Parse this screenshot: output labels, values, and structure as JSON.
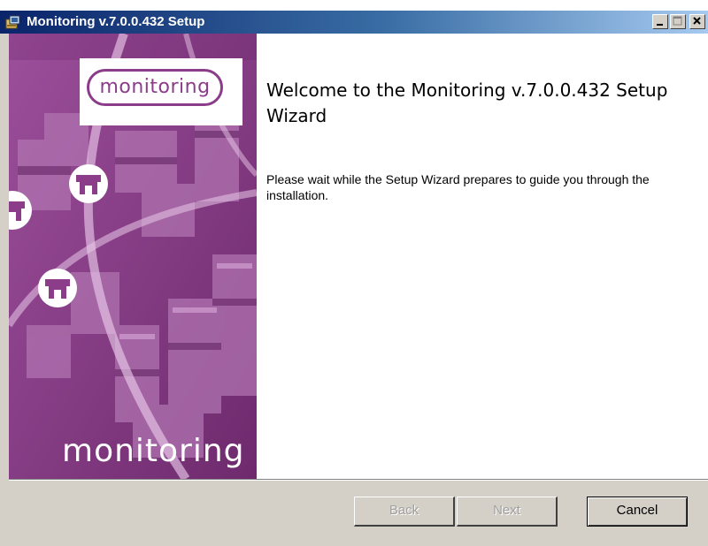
{
  "window": {
    "title": "Monitoring v.7.0.0.432 Setup",
    "controls": {
      "minimize": "minimize",
      "maximize": "maximize",
      "close": "close"
    }
  },
  "side_panel": {
    "logo_text": "monitoring",
    "brand_text": "monitoring",
    "colors": {
      "primary": "#8b3d8a",
      "light": "#c48ac4",
      "dark": "#5e1f5e"
    }
  },
  "content": {
    "title": "Welcome to the Monitoring v.7.0.0.432 Setup Wizard",
    "body": "Please wait while the Setup Wizard prepares to guide you through the installation."
  },
  "buttons": {
    "back": "Back",
    "next": "Next",
    "cancel": "Cancel"
  },
  "icons": [
    "installer-icon",
    "store-icon"
  ]
}
